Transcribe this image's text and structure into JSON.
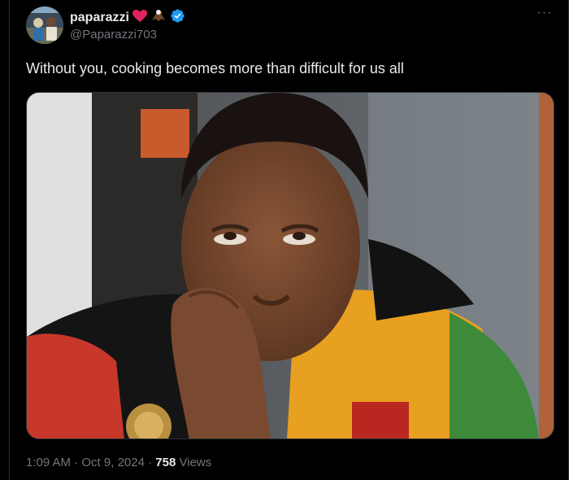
{
  "tweet": {
    "display_name": "paparazzi",
    "handle": "@Paparazzi703",
    "badges": [
      "heart-emoji",
      "eagle-emoji",
      "verified-badge-icon"
    ],
    "text": "Without you, cooking becomes more than difficult for us all",
    "more_label": "···",
    "time": "1:09 AM",
    "separator": " · ",
    "date": "Oct 9, 2024",
    "views_count": "758",
    "views_label": "Views"
  },
  "colors": {
    "background": "#000000",
    "text": "#e7e9ea",
    "muted": "#71767b",
    "verified": "#1d9bf0",
    "heart": "#e0245e"
  }
}
